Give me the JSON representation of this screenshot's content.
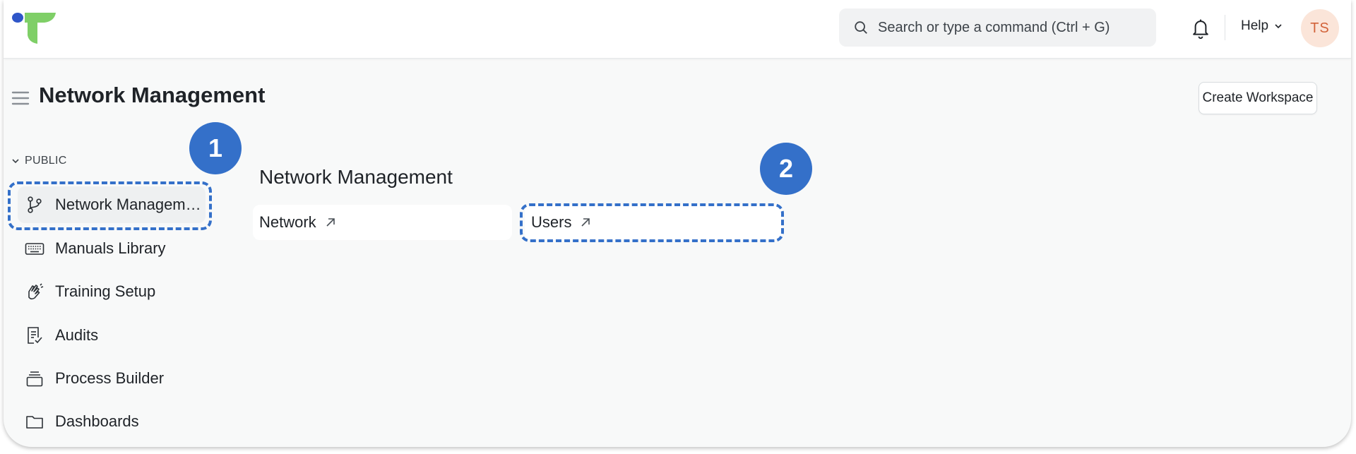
{
  "header": {
    "logo_icon": "app-logo",
    "search_placeholder": "Search or type a command (Ctrl + G)",
    "help_label": "Help",
    "avatar_initials": "TS",
    "accent": "#3470c9"
  },
  "page": {
    "title": "Network Management",
    "create_button": "Create Workspace"
  },
  "sidebar": {
    "section_label": "PUBLIC",
    "items": [
      {
        "label": "Network Management",
        "icon": "git-branch-icon",
        "active": true
      },
      {
        "label": "Manuals Library",
        "icon": "keyboard-icon"
      },
      {
        "label": "Training Setup",
        "icon": "clapping-hands-icon"
      },
      {
        "label": "Audits",
        "icon": "checklist-icon"
      },
      {
        "label": "Process Builder",
        "icon": "layers-icon"
      },
      {
        "label": "Dashboards",
        "icon": "folder-icon"
      }
    ]
  },
  "content": {
    "title": "Network Management",
    "shortcuts": [
      {
        "label": "Network",
        "icon": "arrow-up-right-icon"
      },
      {
        "label": "Users",
        "icon": "arrow-up-right-icon"
      }
    ]
  },
  "annotations": {
    "step1": "1",
    "step2": "2"
  }
}
